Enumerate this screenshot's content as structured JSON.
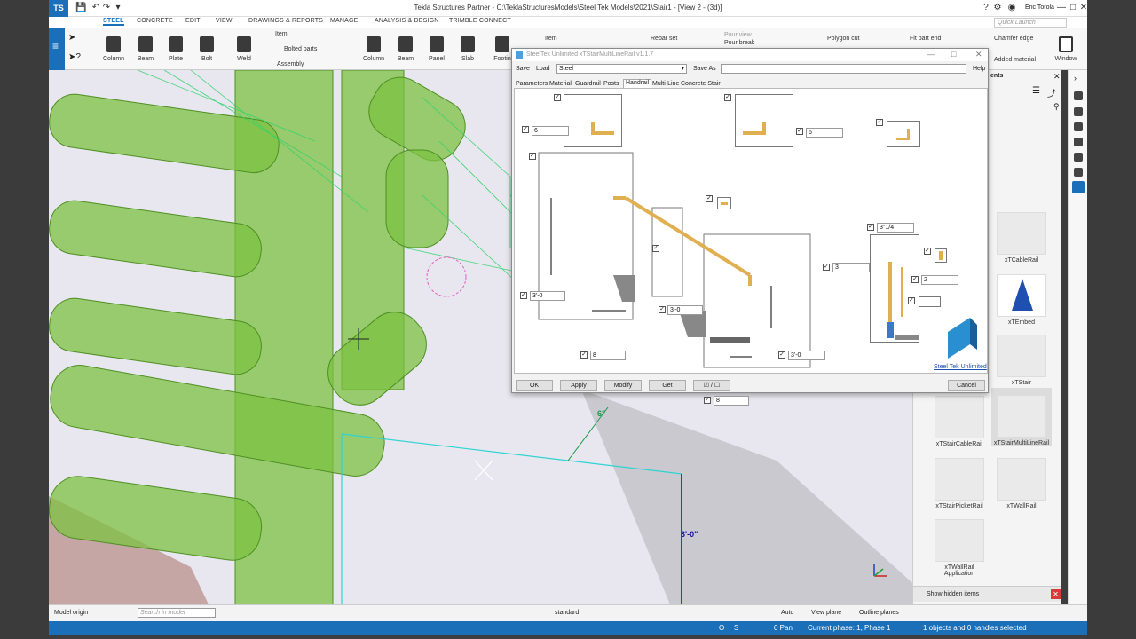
{
  "window": {
    "title": "Tekla Structures Partner - C:\\TeklaStructuresModels\\Steel Tek Models\\2021\\Stair1 - [View 2 - (3d)]",
    "user": "Eric Torola",
    "quick_launch_placeholder": "Quick Launch"
  },
  "menu": [
    "STEEL",
    "CONCRETE",
    "EDIT",
    "VIEW",
    "DRAWINGS & REPORTS",
    "MANAGE",
    "ANALYSIS & DESIGN",
    "TRIMBLE CONNECT"
  ],
  "ribbon": {
    "steel": [
      "Column",
      "Beam",
      "Plate",
      "Bolt",
      "Weld"
    ],
    "steel_small": [
      "Item",
      "Bolted parts",
      "Assembly"
    ],
    "concrete": [
      "Column",
      "Beam",
      "Panel",
      "Slab",
      "Footin"
    ],
    "concrete_small": [
      "Item",
      "Rebar set",
      "Pour view",
      "Pour break"
    ],
    "tools": [
      "Polygon cut",
      "Fit part end",
      "Chamfer edge",
      "Added material",
      "Window"
    ]
  },
  "dialog": {
    "title": "SteelTek Unlimited xTStairMultiLineRail v1.1.7",
    "save_label": "Save",
    "load_label": "Load",
    "load_value": "Steel",
    "save_as_label": "Save As",
    "help_label": "Help",
    "tabs": [
      "Parameters",
      "Material",
      "Guardrail",
      "Posts",
      "Handrail",
      "Multi-Line",
      "Concrete Stair"
    ],
    "active_tab": "Handrail",
    "fields": {
      "top_left": "6",
      "top_mid": "6",
      "rail_height_left": "3'-0",
      "bottom_ext": "8",
      "mid_height": "3'-0",
      "right_height": "3'-0",
      "bottom_ext2": "8",
      "post_top": "3\"1/4",
      "post_offset": "3",
      "post_gap": "2"
    },
    "brand": "Steel Tek Unlimited",
    "buttons": [
      "OK",
      "Apply",
      "Modify",
      "Get",
      "☑ / ☐",
      "Cancel"
    ]
  },
  "viewport": {
    "dim_6": "6\"",
    "dim_3": "3'-0\""
  },
  "right_panel": {
    "header": "ents",
    "items": [
      "xTCableRail",
      "xTEmbed",
      "xTStair",
      "xTStairCableRail",
      "xTStairMultiLineRail",
      "xTStairPicketRail",
      "xTWallRail",
      "xTWallRail Application"
    ],
    "show_hidden": "Show hidden items"
  },
  "bottombar": {
    "model_origin": "Model origin",
    "search_placeholder": "Search in model",
    "standard": "standard",
    "auto": "Auto",
    "view_plane": "View plane",
    "outline_planes": "Outline planes"
  },
  "status": {
    "o": "O",
    "s": "S",
    "pan": "0 Pan",
    "phase": "Current phase: 1, Phase 1",
    "selection": "1 objects and 0 handles selected"
  },
  "colors": {
    "accent": "#1b6fb8",
    "steel_green": "#7cc242",
    "rail_gold": "#e0b050"
  }
}
